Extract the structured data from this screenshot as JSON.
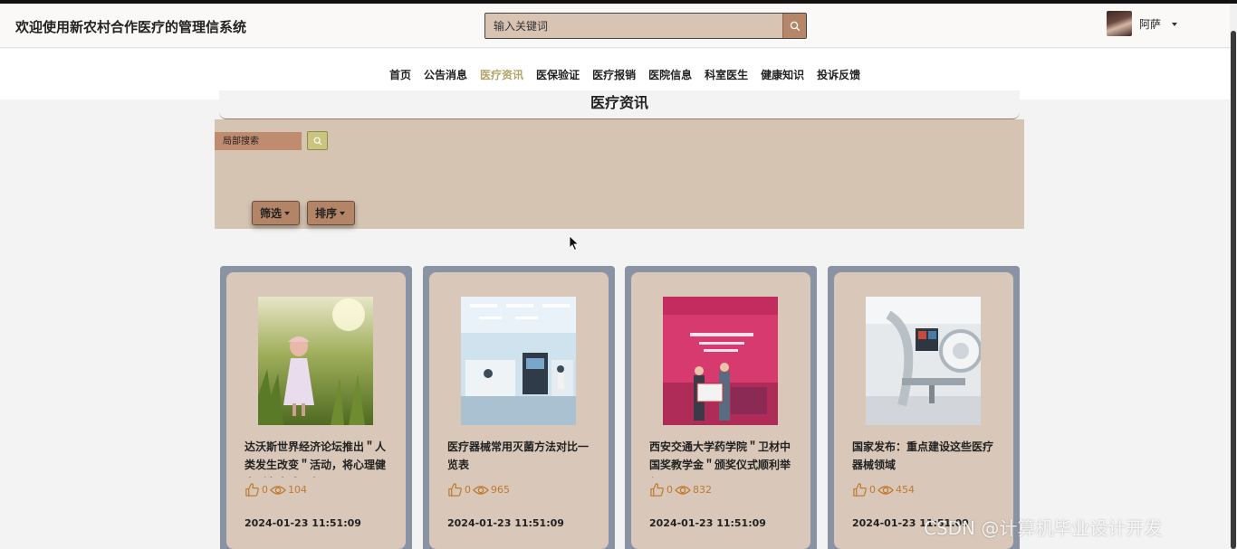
{
  "header": {
    "site_title": "欢迎使用新农村合作医疗的管理信系统",
    "search_placeholder": "输入关键词",
    "user_name": "阿萨"
  },
  "nav": {
    "items": [
      {
        "label": "首页",
        "active": false
      },
      {
        "label": "公告消息",
        "active": false
      },
      {
        "label": "医疗资讯",
        "active": true
      },
      {
        "label": "医保验证",
        "active": false
      },
      {
        "label": "医疗报销",
        "active": false
      },
      {
        "label": "医院信息",
        "active": false
      },
      {
        "label": "科室医生",
        "active": false
      },
      {
        "label": "健康知识",
        "active": false
      },
      {
        "label": "投诉反馈",
        "active": false
      }
    ]
  },
  "section": {
    "title": "医疗资讯"
  },
  "filters": {
    "local_search_placeholder": "局部搜索",
    "filter_label": "筛选",
    "sort_label": "排序"
  },
  "cards": [
    {
      "title": "达沃斯世界经济论坛推出＂人类发生改变＂活动，将心理健康列为全球要务",
      "likes": "0",
      "views": "104",
      "date": "2024-01-23 11:51:09",
      "image": "girl-in-grass-field"
    },
    {
      "title": "医疗器械常用灭菌方法对比一览表",
      "likes": "0",
      "views": "965",
      "date": "2024-01-23 11:51:09",
      "image": "laboratory"
    },
    {
      "title": "西安交通大学药学院＂卫材中国奖教学金＂颁奖仪式顺利举行",
      "likes": "0",
      "views": "832",
      "date": "2024-01-23 11:51:09",
      "image": "award-ceremony"
    },
    {
      "title": "国家发布：重点建设这些医疗器械领域",
      "likes": "0",
      "views": "454",
      "date": "2024-01-23 11:51:09",
      "image": "medical-equipment"
    }
  ],
  "watermark": "CSDN @计算机毕业设计开发",
  "colors": {
    "active_nav": "#b3a46a",
    "card_bg": "#d9c8b9",
    "card_frame": "#8a93a3",
    "filter_panel": "#d6c4b3",
    "stat": "#c07a30"
  }
}
